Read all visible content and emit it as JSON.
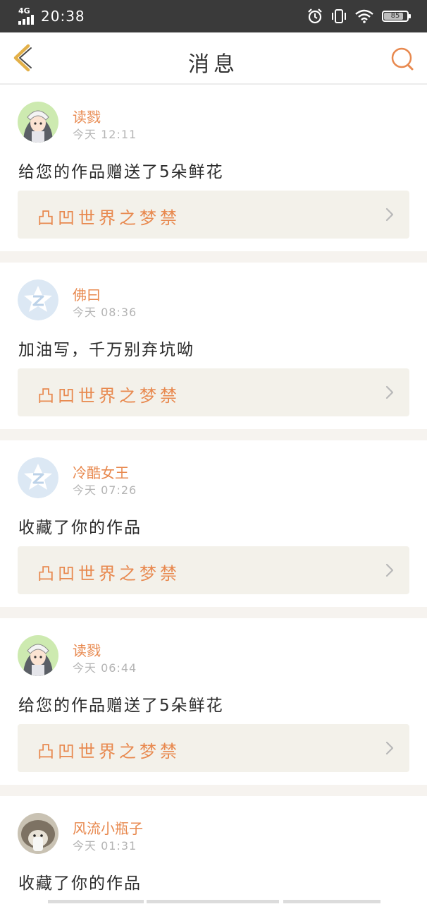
{
  "status_bar": {
    "network": "4G",
    "time": "20:38",
    "battery": "85",
    "battery_level": 0.85
  },
  "header": {
    "title": "消息"
  },
  "colors": {
    "accent": "#e8894f",
    "card_bg": "#ffffff",
    "work_bg": "#f3f1ea",
    "page_bg": "#f6f3ef",
    "timestamp": "#b4b4b4"
  },
  "messages": [
    {
      "avatar_icon": "anime-girl-avatar",
      "username": "读戮",
      "time": "今天 12:11",
      "text": "给您的作品赠送了5朵鲜花",
      "work_title": "凸凹世界之梦禁"
    },
    {
      "avatar_icon": "default-z-avatar",
      "username": "佛曰",
      "time": "今天 08:36",
      "text": "加油写，千万别弃坑呦",
      "work_title": "凸凹世界之梦禁"
    },
    {
      "avatar_icon": "default-z-avatar",
      "username": "冷酷女王",
      "time": "今天 07:26",
      "text": "收藏了你的作品",
      "work_title": "凸凹世界之梦禁"
    },
    {
      "avatar_icon": "anime-girl-avatar",
      "username": "读戮",
      "time": "今天 06:44",
      "text": "给您的作品赠送了5朵鲜花",
      "work_title": "凸凹世界之梦禁"
    },
    {
      "avatar_icon": "hedgehog-photo-avatar",
      "username": "风流小瓶子",
      "time": "今天 01:31",
      "text": "收藏了你的作品",
      "work_title": ""
    }
  ]
}
